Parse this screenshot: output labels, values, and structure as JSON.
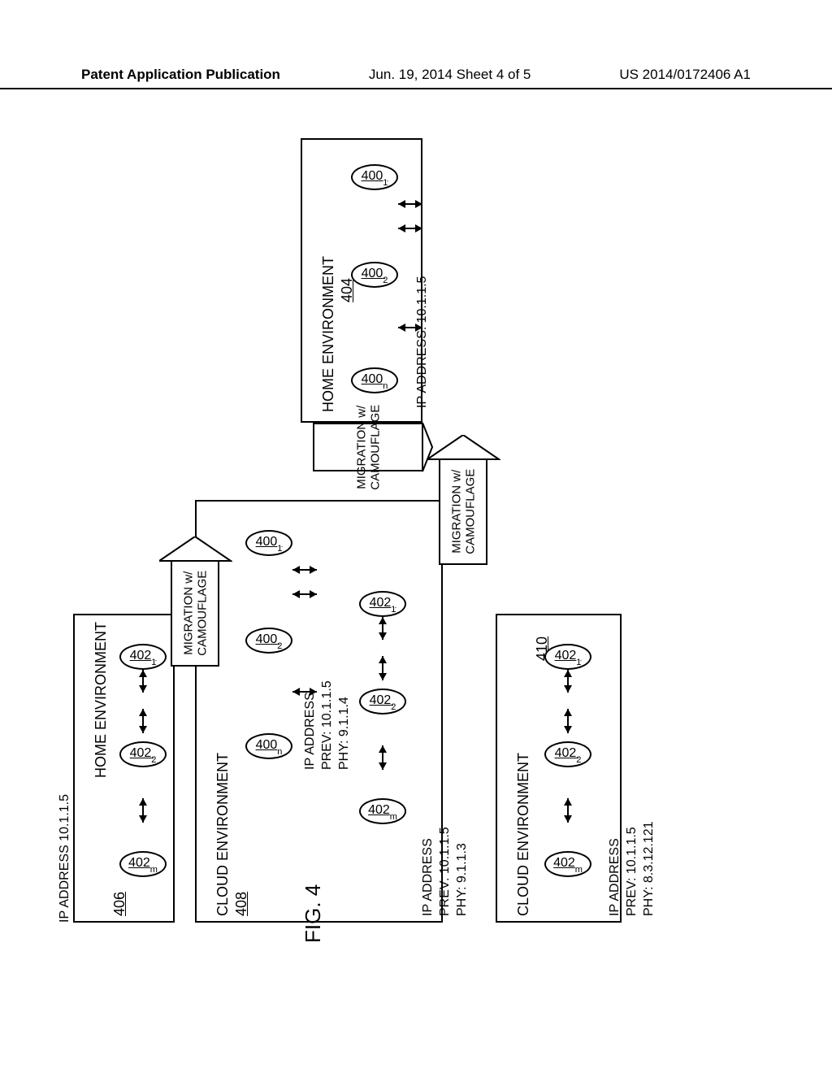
{
  "header": {
    "left": "Patent Application Publication",
    "center": "Jun. 19, 2014  Sheet 4 of 5",
    "right": "US 2014/0172406 A1"
  },
  "figure_label": "FIG. 4",
  "environments": {
    "home404": {
      "label": "HOME ENVIRONMENT",
      "ref": "404",
      "ip": "IP ADDRESS: 10.1.1.5"
    },
    "home406": {
      "label": "HOME ENVIRONMENT",
      "ref": "406",
      "ip": "IP ADDRESS  10.1.1.5"
    },
    "cloud408": {
      "label": "CLOUD  ENVIRONMENT",
      "ref": "408",
      "ip_a": "IP ADDRESS\nPREV: 10.1.1.5\nPHY: 9.1.1.4",
      "ip_b": "IP ADDRESS\nPREV: 10.1.1.5\nPHY: 9.1.1.3"
    },
    "cloud410": {
      "label": "CLOUD ENVIRONMENT",
      "ref": "410",
      "ip": "IP ADDRESS\nPREV: 10.1.1.5\nPHY: 8.3.12.121"
    }
  },
  "nodes": {
    "n400": "400",
    "n402": "402",
    "sub1": "1",
    "sub2": "2",
    "subn": "n",
    "subm": "m"
  },
  "migration_label": "MIGRATION w/\nCAMOUFLAGE",
  "chart_data": {
    "type": "diagram",
    "title": "FIG. 4",
    "elements": [
      {
        "id": "404",
        "type": "environment",
        "name": "HOME ENVIRONMENT",
        "nodes": [
          "400_1",
          "400_2",
          "400_n"
        ],
        "ip_address": "10.1.1.5"
      },
      {
        "id": "406",
        "type": "environment",
        "name": "HOME ENVIRONMENT",
        "nodes": [
          "402_1",
          "402_2",
          "402_m"
        ],
        "ip_address": "10.1.1.5"
      },
      {
        "id": "408",
        "type": "environment",
        "name": "CLOUD ENVIRONMENT",
        "groups": [
          {
            "nodes": [
              "400_1",
              "400_2",
              "400_n"
            ],
            "ip_prev": "10.1.1.5",
            "ip_phy": "9.1.1.4"
          },
          {
            "nodes": [
              "402_1",
              "402_2",
              "402_m"
            ],
            "ip_prev": "10.1.1.5",
            "ip_phy": "9.1.1.3"
          }
        ]
      },
      {
        "id": "410",
        "type": "environment",
        "name": "CLOUD ENVIRONMENT",
        "nodes": [
          "402_1",
          "402_2",
          "402_m"
        ],
        "ip_prev": "10.1.1.5",
        "ip_phy": "8.3.12.121"
      }
    ],
    "transitions": [
      {
        "from": "404",
        "to": "408",
        "label": "MIGRATION w/ CAMOUFLAGE"
      },
      {
        "from": "406",
        "to": "408",
        "label": "MIGRATION w/ CAMOUFLAGE"
      },
      {
        "from": "408",
        "to": "410",
        "label": "MIGRATION w/ CAMOUFLAGE"
      }
    ]
  }
}
